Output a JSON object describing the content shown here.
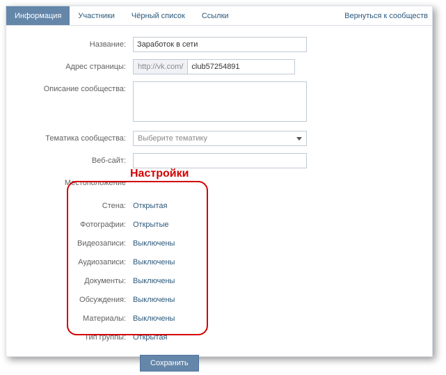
{
  "tabs": {
    "info": "Информация",
    "members": "Участники",
    "blacklist": "Чёрный список",
    "links": "Ссылки"
  },
  "back_link": "Вернуться к сообществ",
  "labels": {
    "name": "Название:",
    "address": "Адрес страницы:",
    "description": "Описание сообщества:",
    "topic": "Тематика сообщества:",
    "website": "Веб-сайт:",
    "location": "Местоположение"
  },
  "fields": {
    "name_value": "Заработок в сети",
    "url_prefix": "http://vk.com/",
    "url_value": "club57254891",
    "description_value": "",
    "topic_placeholder": "Выберите тематику",
    "website_value": ""
  },
  "annotation_title": "Настройки",
  "settings": [
    {
      "label": "Стена:",
      "value": "Открытая"
    },
    {
      "label": "Фотографии:",
      "value": "Открытые"
    },
    {
      "label": "Видеозаписи:",
      "value": "Выключены"
    },
    {
      "label": "Аудиозаписи:",
      "value": "Выключены"
    },
    {
      "label": "Документы:",
      "value": "Выключены"
    },
    {
      "label": "Обсуждения:",
      "value": "Выключены"
    },
    {
      "label": "Материалы:",
      "value": "Выключены"
    },
    {
      "label": "Тип группы:",
      "value": "Открытая"
    }
  ],
  "save_button": "Сохранить"
}
